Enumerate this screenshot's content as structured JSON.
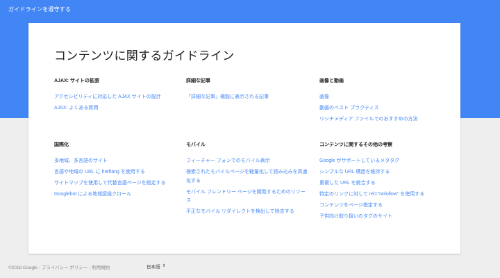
{
  "header": {
    "title": "ガイドラインを遵守する"
  },
  "main": {
    "title": "コンテンツに関するガイドライン",
    "sections": [
      {
        "title": "AJAX: サイトの拡張",
        "links": [
          "アクセシビリティに対応した AJAX サイトの設計",
          "AJAX: よくある質問"
        ]
      },
      {
        "title": "詳細な記事",
        "links": [
          "「詳細な記事」機能に表示される記事"
        ]
      },
      {
        "title": "画像と動画",
        "links": [
          "画像",
          "動画のベスト プラクティス",
          "リッチメディア ファイルでのおすすめの方法"
        ]
      },
      {
        "title": "国際化",
        "links": [
          "多地域、多言語のサイト",
          "言語や地域の URL に hreflang を使用する",
          "サイトマップを使用して代替言語ページを指定する",
          "Googlebot による地域認識クロール"
        ]
      },
      {
        "title": "モバイル",
        "links": [
          "フィーチャー フォンでのモバイル表示",
          "検索されたモバイルページを軽量化して読み込みを高速化する",
          "モバイル フレンドリー ページを開発するためのリソース",
          "不正なモバイル リダイレクトを検出して除去する"
        ]
      },
      {
        "title": "コンテンツに関するその他の考察",
        "links": [
          "Google がサポートしているメタタグ",
          "シンプルな URL 構造を維持する",
          "重複した URL を統合する",
          "特定のリンクに対して rel=\"nofollow\" を使用する",
          "コンテンツをページ指定する",
          "子供向け取り扱いのタグのサイト"
        ]
      }
    ]
  },
  "footer": {
    "text": "©2018 Google - プライバシー ポリシー - 利用規約",
    "language": "日本語",
    "language_arrows": "⇕"
  }
}
